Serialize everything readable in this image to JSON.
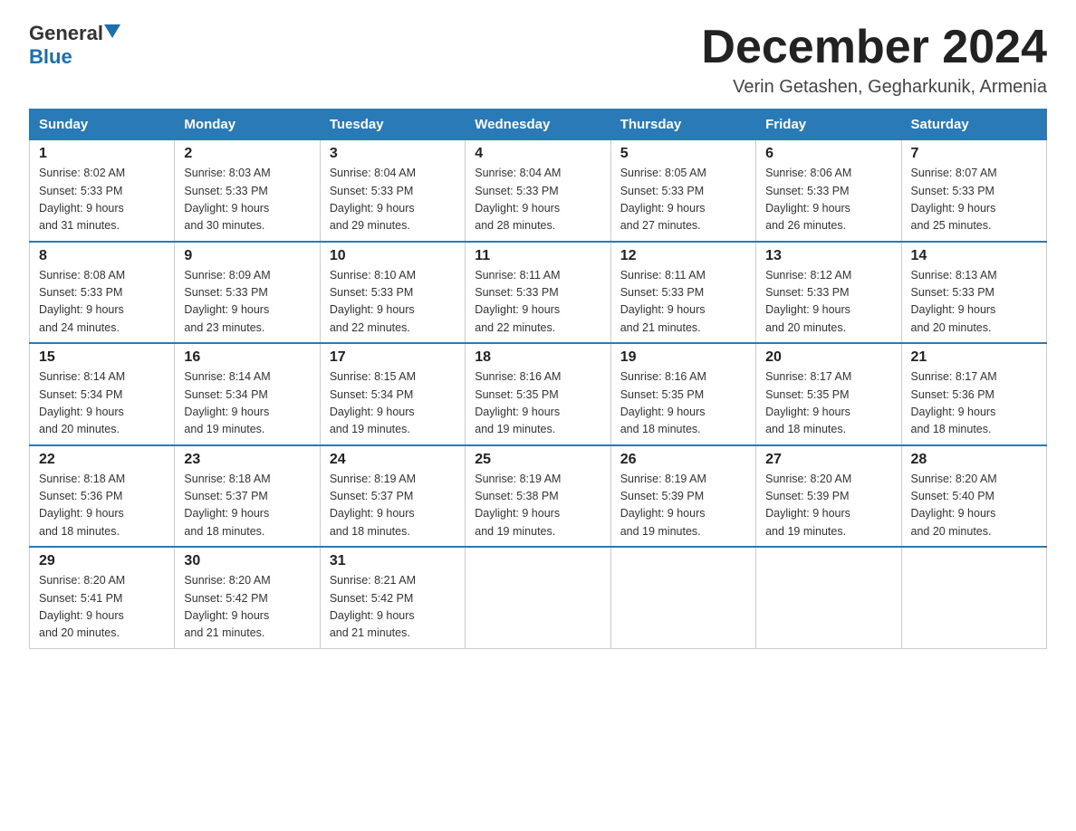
{
  "logo": {
    "text_general": "General",
    "text_blue": "Blue"
  },
  "title": {
    "month": "December 2024",
    "location": "Verin Getashen, Gegharkunik, Armenia"
  },
  "weekdays": [
    "Sunday",
    "Monday",
    "Tuesday",
    "Wednesday",
    "Thursday",
    "Friday",
    "Saturday"
  ],
  "weeks": [
    [
      {
        "day": "1",
        "sunrise": "8:02 AM",
        "sunset": "5:33 PM",
        "daylight": "9 hours and 31 minutes."
      },
      {
        "day": "2",
        "sunrise": "8:03 AM",
        "sunset": "5:33 PM",
        "daylight": "9 hours and 30 minutes."
      },
      {
        "day": "3",
        "sunrise": "8:04 AM",
        "sunset": "5:33 PM",
        "daylight": "9 hours and 29 minutes."
      },
      {
        "day": "4",
        "sunrise": "8:04 AM",
        "sunset": "5:33 PM",
        "daylight": "9 hours and 28 minutes."
      },
      {
        "day": "5",
        "sunrise": "8:05 AM",
        "sunset": "5:33 PM",
        "daylight": "9 hours and 27 minutes."
      },
      {
        "day": "6",
        "sunrise": "8:06 AM",
        "sunset": "5:33 PM",
        "daylight": "9 hours and 26 minutes."
      },
      {
        "day": "7",
        "sunrise": "8:07 AM",
        "sunset": "5:33 PM",
        "daylight": "9 hours and 25 minutes."
      }
    ],
    [
      {
        "day": "8",
        "sunrise": "8:08 AM",
        "sunset": "5:33 PM",
        "daylight": "9 hours and 24 minutes."
      },
      {
        "day": "9",
        "sunrise": "8:09 AM",
        "sunset": "5:33 PM",
        "daylight": "9 hours and 23 minutes."
      },
      {
        "day": "10",
        "sunrise": "8:10 AM",
        "sunset": "5:33 PM",
        "daylight": "9 hours and 22 minutes."
      },
      {
        "day": "11",
        "sunrise": "8:11 AM",
        "sunset": "5:33 PM",
        "daylight": "9 hours and 22 minutes."
      },
      {
        "day": "12",
        "sunrise": "8:11 AM",
        "sunset": "5:33 PM",
        "daylight": "9 hours and 21 minutes."
      },
      {
        "day": "13",
        "sunrise": "8:12 AM",
        "sunset": "5:33 PM",
        "daylight": "9 hours and 20 minutes."
      },
      {
        "day": "14",
        "sunrise": "8:13 AM",
        "sunset": "5:33 PM",
        "daylight": "9 hours and 20 minutes."
      }
    ],
    [
      {
        "day": "15",
        "sunrise": "8:14 AM",
        "sunset": "5:34 PM",
        "daylight": "9 hours and 20 minutes."
      },
      {
        "day": "16",
        "sunrise": "8:14 AM",
        "sunset": "5:34 PM",
        "daylight": "9 hours and 19 minutes."
      },
      {
        "day": "17",
        "sunrise": "8:15 AM",
        "sunset": "5:34 PM",
        "daylight": "9 hours and 19 minutes."
      },
      {
        "day": "18",
        "sunrise": "8:16 AM",
        "sunset": "5:35 PM",
        "daylight": "9 hours and 19 minutes."
      },
      {
        "day": "19",
        "sunrise": "8:16 AM",
        "sunset": "5:35 PM",
        "daylight": "9 hours and 18 minutes."
      },
      {
        "day": "20",
        "sunrise": "8:17 AM",
        "sunset": "5:35 PM",
        "daylight": "9 hours and 18 minutes."
      },
      {
        "day": "21",
        "sunrise": "8:17 AM",
        "sunset": "5:36 PM",
        "daylight": "9 hours and 18 minutes."
      }
    ],
    [
      {
        "day": "22",
        "sunrise": "8:18 AM",
        "sunset": "5:36 PM",
        "daylight": "9 hours and 18 minutes."
      },
      {
        "day": "23",
        "sunrise": "8:18 AM",
        "sunset": "5:37 PM",
        "daylight": "9 hours and 18 minutes."
      },
      {
        "day": "24",
        "sunrise": "8:19 AM",
        "sunset": "5:37 PM",
        "daylight": "9 hours and 18 minutes."
      },
      {
        "day": "25",
        "sunrise": "8:19 AM",
        "sunset": "5:38 PM",
        "daylight": "9 hours and 19 minutes."
      },
      {
        "day": "26",
        "sunrise": "8:19 AM",
        "sunset": "5:39 PM",
        "daylight": "9 hours and 19 minutes."
      },
      {
        "day": "27",
        "sunrise": "8:20 AM",
        "sunset": "5:39 PM",
        "daylight": "9 hours and 19 minutes."
      },
      {
        "day": "28",
        "sunrise": "8:20 AM",
        "sunset": "5:40 PM",
        "daylight": "9 hours and 20 minutes."
      }
    ],
    [
      {
        "day": "29",
        "sunrise": "8:20 AM",
        "sunset": "5:41 PM",
        "daylight": "9 hours and 20 minutes."
      },
      {
        "day": "30",
        "sunrise": "8:20 AM",
        "sunset": "5:42 PM",
        "daylight": "9 hours and 21 minutes."
      },
      {
        "day": "31",
        "sunrise": "8:21 AM",
        "sunset": "5:42 PM",
        "daylight": "9 hours and 21 minutes."
      },
      null,
      null,
      null,
      null
    ]
  ],
  "labels": {
    "sunrise": "Sunrise:",
    "sunset": "Sunset:",
    "daylight": "Daylight:"
  }
}
